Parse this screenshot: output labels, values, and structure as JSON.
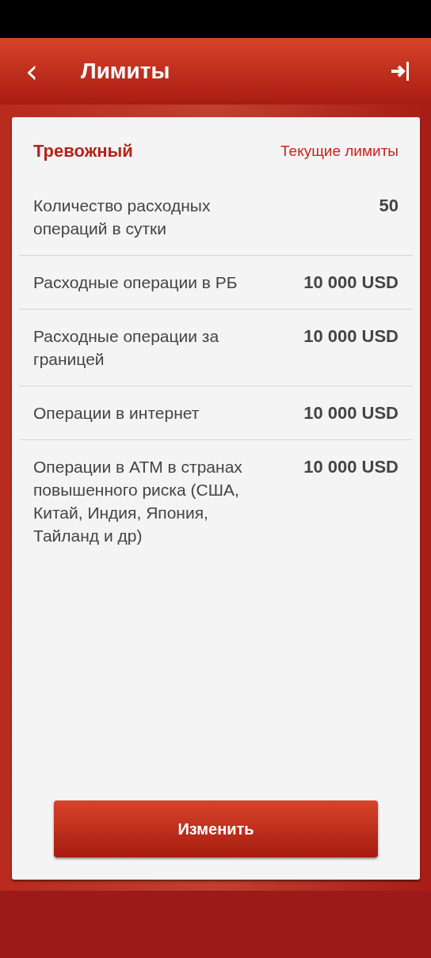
{
  "header": {
    "title": "Лимиты",
    "back": "‹"
  },
  "card": {
    "profile": "Тревожный",
    "link": "Текущие лимиты",
    "rows": [
      {
        "label": "Количество расходных операций в сутки",
        "value": "50"
      },
      {
        "label": "Расходные операции в РБ",
        "value": "10 000 USD"
      },
      {
        "label": "Расходные операции за границей",
        "value": "10 000 USD"
      },
      {
        "label": "Операции в интернет",
        "value": "10 000 USD"
      },
      {
        "label": "Операции в АТМ в странах повышенного риска (США, Китай, Индия, Япония, Тайланд и др)",
        "value": "10 000 USD"
      }
    ],
    "button": "Изменить"
  }
}
